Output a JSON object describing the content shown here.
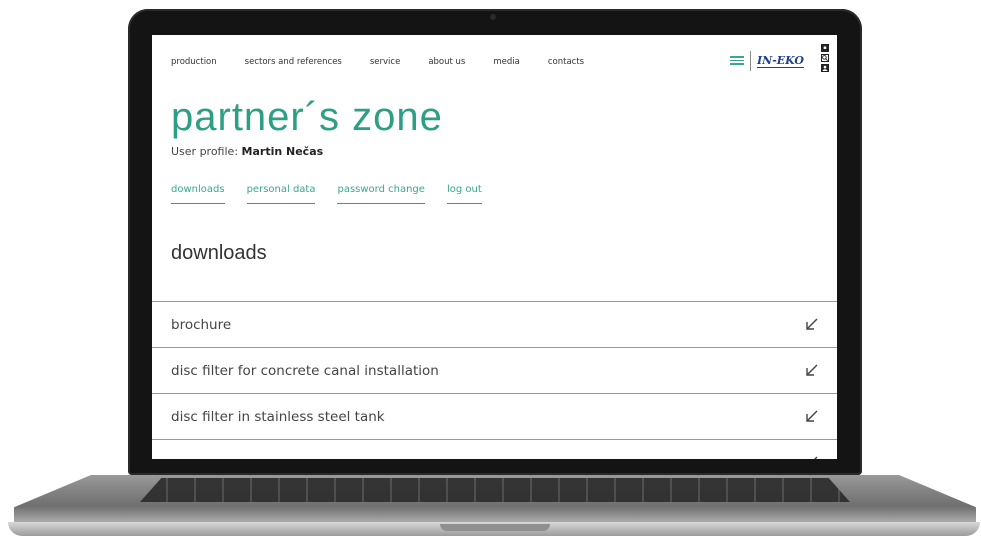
{
  "nav": {
    "items": [
      "production",
      "sectors and references",
      "service",
      "about us",
      "media",
      "contacts"
    ]
  },
  "logo": {
    "text": "IN-EKO"
  },
  "page": {
    "title": "partner´s zone",
    "user_label": "User profile:",
    "user_name": "Martin Nečas"
  },
  "subnav": {
    "items": [
      "downloads",
      "personal data",
      "password change",
      "log out"
    ]
  },
  "section": {
    "title": "downloads"
  },
  "downloads": [
    {
      "label": "brochure",
      "icon": "download-arrow-icon"
    },
    {
      "label": "disc filter for concrete canal installation",
      "icon": "download-arrow-icon"
    },
    {
      "label": "disc filter in stainless steel tank",
      "icon": "download-arrow-icon"
    },
    {
      "label": "",
      "icon": "download-arrow-icon"
    }
  ],
  "colors": {
    "accent": "#2e9e84",
    "logo": "#1e3f8a"
  }
}
